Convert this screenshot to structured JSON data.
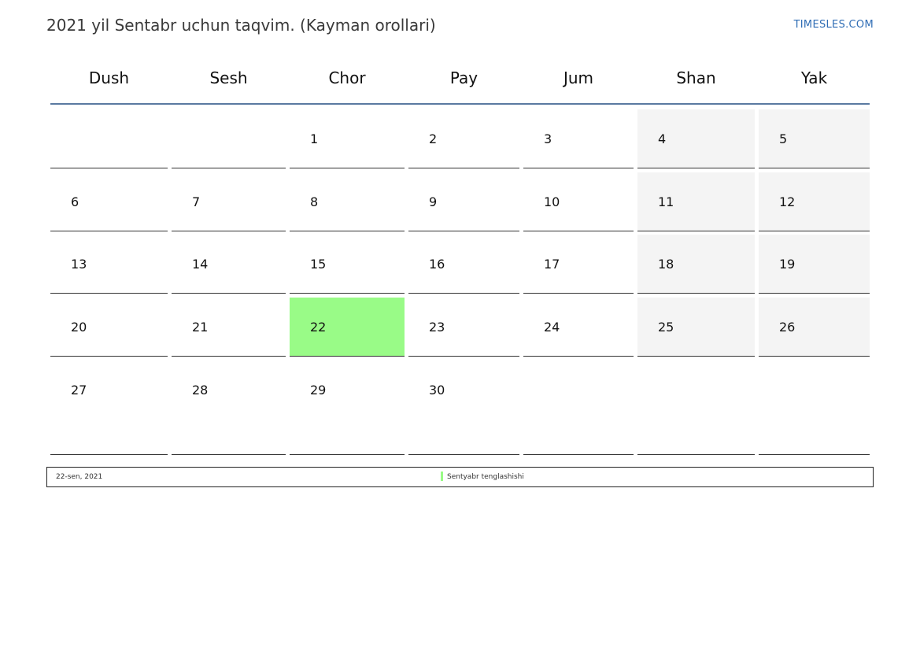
{
  "header": {
    "title": "2021 yil Sentabr uchun taqvim. (Kayman orollari)",
    "site": "TIMESLES.COM"
  },
  "weekdays": [
    "Dush",
    "Sesh",
    "Chor",
    "Pay",
    "Jum",
    "Shan",
    "Yak"
  ],
  "weeks": [
    [
      "",
      "",
      "1",
      "2",
      "3",
      "4",
      "5"
    ],
    [
      "6",
      "7",
      "8",
      "9",
      "10",
      "11",
      "12"
    ],
    [
      "13",
      "14",
      "15",
      "16",
      "17",
      "18",
      "19"
    ],
    [
      "20",
      "21",
      "22",
      "23",
      "24",
      "25",
      "26"
    ],
    [
      "27",
      "28",
      "29",
      "30",
      "",
      "",
      ""
    ]
  ],
  "highlight": {
    "day": "22",
    "color": "#99fb87"
  },
  "weekend_color": "#f4f4f4",
  "header_rule_color": "#5a7aa1",
  "footer": {
    "date": "22-sen, 2021",
    "event": "Sentyabr tenglashishi"
  }
}
